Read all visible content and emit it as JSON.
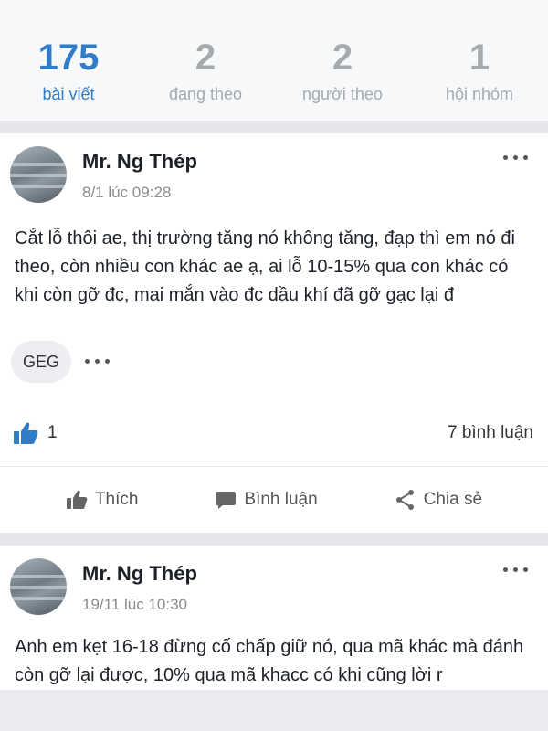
{
  "stats": [
    {
      "num": "175",
      "label": "bài viết"
    },
    {
      "num": "2",
      "label": "đang theo"
    },
    {
      "num": "2",
      "label": "người theo"
    },
    {
      "num": "1",
      "label": "hội nhóm"
    }
  ],
  "posts": [
    {
      "author": "Mr. Ng Thép",
      "time": "8/1 lúc 09:28",
      "content": "Cắt lỗ thôi ae, thị trường tăng nó không tăng, đạp thì em nó đi theo, còn nhiều con khác ae ạ, ai lỗ 10-15% qua con khác có khi còn gỡ đc, mai mắn vào đc dầu khí đã gỡ gạc lại đ",
      "tag": "GEG",
      "likes": "1",
      "comments": "7 bình luận"
    },
    {
      "author": "Mr. Ng Thép",
      "time": "19/11 lúc 10:30",
      "content": "Anh em kẹt 16-18 đừng cố chấp giữ nó, qua mã khác mà đánh còn gỡ lại được, 10% qua mã khacc có khi cũng lời r"
    }
  ],
  "actions": {
    "like": "Thích",
    "comment": "Bình luận",
    "share": "Chia sẻ"
  },
  "colors": {
    "accent": "#2e7dc6",
    "muted": "#a6a9ad"
  },
  "icons": {
    "like": "thumbs-up-icon",
    "comment": "comment-bubble-icon",
    "share": "share-icon",
    "more": "more-dots-icon"
  }
}
